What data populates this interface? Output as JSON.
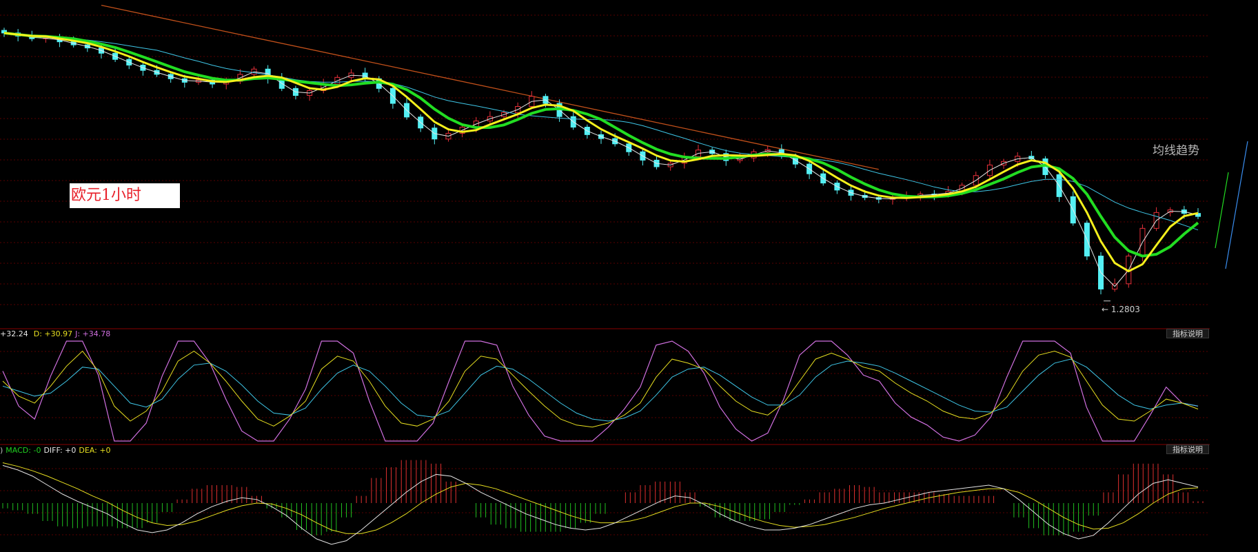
{
  "chart_labels": {
    "title_box": "欧元1小时",
    "trend_label": "均线趋势",
    "low_annotation": "1.2803"
  },
  "kdj": {
    "k_text": "32.24",
    "d_text": "D: +30.97",
    "j_text": "J: +34.78",
    "button": "指标说明"
  },
  "macd": {
    "prefix": ")",
    "macd_text": "MACD: -0",
    "diff_text": "DIFF: +0",
    "dea_text": "DEA: +0",
    "button": "指标说明"
  },
  "colors": {
    "background": "#000000",
    "grid": "#5a0000",
    "candle_up": "#e8303a",
    "candle_down": "#54f0f4",
    "ma_yellow": "#f5f01c",
    "ma_green": "#22dd22",
    "ma_cyan": "#3fc7e8",
    "ma_white": "#e6e6e6",
    "trendline": "#c2501a",
    "kdj_k": "#e6e6e6",
    "kdj_d": "#e8e020",
    "kdj_j": "#d070e0",
    "macd_diff": "#e6e6e6",
    "macd_dea": "#e8e020",
    "hist_pos": "#e03030",
    "hist_neg": "#20c020"
  },
  "chart_data": {
    "type": "candlestick",
    "instrument": "欧元",
    "timeframe": "1小时",
    "price_anchor": {
      "index": 79,
      "low": 1.2803
    },
    "closes": [
      1.3412,
      1.3405,
      1.3399,
      1.3401,
      1.3392,
      1.3385,
      1.3378,
      1.3366,
      1.3352,
      1.3339,
      1.3327,
      1.3318,
      1.3308,
      1.33,
      1.3305,
      1.3296,
      1.3302,
      1.3318,
      1.333,
      1.3309,
      1.3286,
      1.327,
      1.3281,
      1.3296,
      1.3311,
      1.3321,
      1.3308,
      1.3286,
      1.3252,
      1.3221,
      1.3196,
      1.3171,
      1.3184,
      1.3198,
      1.3212,
      1.3222,
      1.3231,
      1.3245,
      1.3268,
      1.3252,
      1.3222,
      1.3198,
      1.3181,
      1.3172,
      1.316,
      1.3142,
      1.3123,
      1.3108,
      1.3116,
      1.3131,
      1.3146,
      1.3138,
      1.3122,
      1.3128,
      1.3142,
      1.3147,
      1.3132,
      1.3114,
      1.3092,
      1.3071,
      1.3055,
      1.3043,
      1.3038,
      1.3034,
      1.3036,
      1.304,
      1.3046,
      1.3044,
      1.3052,
      1.3066,
      1.3088,
      1.3112,
      1.312,
      1.3132,
      1.3126,
      1.309,
      1.304,
      1.298,
      1.2905,
      1.283,
      1.2842,
      1.2905,
      1.2968,
      1.3004,
      1.301,
      1.3002,
      1.2995
    ],
    "kdj_k": [
      60,
      45,
      38,
      55,
      75,
      90,
      70,
      35,
      20,
      30,
      50,
      80,
      90,
      78,
      60,
      40,
      22,
      15,
      25,
      40,
      72,
      85,
      80,
      60,
      35,
      18,
      15,
      22,
      40,
      70,
      85,
      82,
      66,
      50,
      35,
      22,
      16,
      14,
      18,
      26,
      38,
      64,
      82,
      78,
      72,
      55,
      40,
      30,
      26,
      38,
      60,
      82,
      88,
      82,
      74,
      70,
      58,
      48,
      40,
      30,
      24,
      22,
      28,
      44,
      70,
      86,
      90,
      84,
      60,
      36,
      22,
      20,
      30,
      42,
      38,
      32
    ],
    "kdj_d": [
      55,
      50,
      45,
      48,
      60,
      74,
      72,
      55,
      38,
      34,
      42,
      62,
      76,
      78,
      70,
      56,
      40,
      28,
      26,
      33,
      52,
      68,
      76,
      70,
      55,
      38,
      26,
      24,
      30,
      48,
      66,
      75,
      72,
      62,
      50,
      38,
      28,
      22,
      20,
      23,
      30,
      46,
      64,
      72,
      74,
      66,
      55,
      44,
      36,
      36,
      46,
      64,
      76,
      80,
      78,
      75,
      68,
      60,
      52,
      44,
      36,
      30,
      29,
      34,
      50,
      66,
      78,
      82,
      74,
      60,
      46,
      36,
      32,
      36,
      38,
      35
    ],
    "kdj_j": [
      70,
      35,
      22,
      65,
      100,
      100,
      66,
      0,
      0,
      18,
      65,
      100,
      100,
      78,
      42,
      10,
      0,
      0,
      22,
      52,
      100,
      100,
      88,
      40,
      0,
      0,
      0,
      18,
      60,
      100,
      100,
      96,
      55,
      26,
      5,
      0,
      0,
      0,
      14,
      32,
      54,
      96,
      100,
      90,
      68,
      34,
      12,
      0,
      8,
      42,
      86,
      100,
      100,
      86,
      66,
      60,
      38,
      24,
      16,
      4,
      0,
      6,
      24,
      64,
      100,
      100,
      100,
      88,
      34,
      0,
      0,
      0,
      26,
      54,
      38,
      35
    ],
    "macd_diff": [
      0.0042,
      0.0037,
      0.003,
      0.002,
      0.001,
      0.0002,
      -0.0005,
      -0.0012,
      -0.0022,
      -0.003,
      -0.0033,
      -0.003,
      -0.0022,
      -0.0012,
      -0.0004,
      0.0002,
      0.0006,
      0.0004,
      -0.0004,
      -0.0014,
      -0.0028,
      -0.004,
      -0.0046,
      -0.0042,
      -0.003,
      -0.0016,
      -0.0002,
      0.0012,
      0.0024,
      0.0032,
      0.003,
      0.0022,
      0.0012,
      0.0004,
      -0.0004,
      -0.0012,
      -0.0018,
      -0.0024,
      -0.0028,
      -0.003,
      -0.0028,
      -0.0022,
      -0.0014,
      -0.0006,
      0.0002,
      0.0008,
      0.0006,
      -0.0002,
      -0.0012,
      -0.002,
      -0.0026,
      -0.003,
      -0.003,
      -0.0028,
      -0.0024,
      -0.0018,
      -0.0012,
      -0.0006,
      -0.0002,
      0.0,
      0.0004,
      0.0008,
      0.0012,
      0.0014,
      0.0016,
      0.0018,
      0.002,
      0.0016,
      0.0004,
      -0.001,
      -0.0024,
      -0.0034,
      -0.004,
      -0.0036,
      -0.0022,
      -0.0006,
      0.001,
      0.0022,
      0.0026,
      0.0022,
      0.0018
    ],
    "macd_dea": [
      0.0045,
      0.0041,
      0.0036,
      0.003,
      0.0023,
      0.0016,
      0.0008,
      0.0001,
      -0.0008,
      -0.0016,
      -0.0022,
      -0.0025,
      -0.0024,
      -0.002,
      -0.0014,
      -0.0008,
      -0.0003,
      0.0,
      -0.0001,
      -0.0006,
      -0.0013,
      -0.0022,
      -0.003,
      -0.0034,
      -0.0034,
      -0.003,
      -0.0022,
      -0.0012,
      0.0,
      0.001,
      0.0018,
      0.0022,
      0.002,
      0.0016,
      0.001,
      0.0004,
      -0.0002,
      -0.0008,
      -0.0014,
      -0.0019,
      -0.0022,
      -0.0022,
      -0.002,
      -0.0016,
      -0.001,
      -0.0004,
      0.0,
      0.0,
      -0.0004,
      -0.001,
      -0.0016,
      -0.0021,
      -0.0025,
      -0.0027,
      -0.0026,
      -0.0024,
      -0.002,
      -0.0016,
      -0.0011,
      -0.0006,
      -0.0002,
      0.0002,
      0.0006,
      0.0009,
      0.0012,
      0.0014,
      0.0016,
      0.0016,
      0.0012,
      0.0004,
      -0.0006,
      -0.0016,
      -0.0024,
      -0.0029,
      -0.0028,
      -0.0022,
      -0.0012,
      0.0,
      0.001,
      0.0016,
      0.0017
    ]
  }
}
